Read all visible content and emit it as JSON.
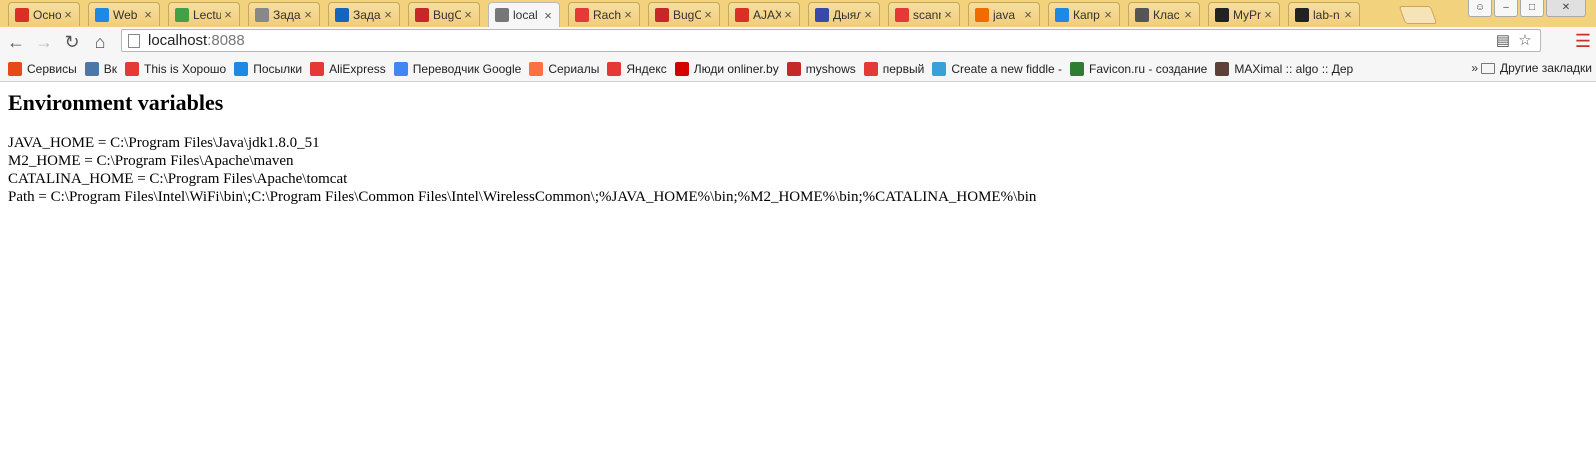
{
  "tabs": [
    {
      "title": "Осно",
      "icon": "person-icon",
      "color": "#d93025"
    },
    {
      "title": "Web",
      "icon": "drive-icon",
      "color": "#1e88e5"
    },
    {
      "title": "Lectu",
      "icon": "drive-icon",
      "color": "#43a047"
    },
    {
      "title": "Зада",
      "icon": "ir2-icon",
      "color": "#888888"
    },
    {
      "title": "Зада",
      "icon": "table-icon",
      "color": "#1565c0"
    },
    {
      "title": "BugC",
      "icon": "bug-icon",
      "color": "#c62828"
    },
    {
      "title": "local",
      "icon": "page-icon",
      "color": "#777777"
    },
    {
      "title": "Rach",
      "icon": "shop-icon",
      "color": "#e53935"
    },
    {
      "title": "BugC",
      "icon": "bug-icon",
      "color": "#c62828"
    },
    {
      "title": "AJAX",
      "icon": "person-icon",
      "color": "#d93025"
    },
    {
      "title": "Дыял",
      "icon": "chat-icon",
      "color": "#3949ab"
    },
    {
      "title": "scann",
      "icon": "yandex-icon",
      "color": "#e53935"
    },
    {
      "title": "java",
      "icon": "java-icon",
      "color": "#ef6c00"
    },
    {
      "title": "Капр",
      "icon": "nodes-icon",
      "color": "#1e88e5"
    },
    {
      "title": "Клас",
      "icon": "gear-icon",
      "color": "#555555"
    },
    {
      "title": "MyPr",
      "icon": "github-icon",
      "color": "#222222"
    },
    {
      "title": "lab-n",
      "icon": "github-icon",
      "color": "#222222"
    }
  ],
  "active_tab_index": 6,
  "address": {
    "host": "localhost",
    "port": ":8088"
  },
  "bookmarks": [
    {
      "label": "Сервисы",
      "icon": "apps-icon",
      "color": "#e64a19"
    },
    {
      "label": "Вк",
      "icon": "vk-icon",
      "color": "#4a76a8"
    },
    {
      "label": "This is Хорошо",
      "icon": "youtube-icon",
      "color": "#e53935"
    },
    {
      "label": "Посылки",
      "icon": "package-icon",
      "color": "#1e88e5"
    },
    {
      "label": "AliExpress",
      "icon": "aliexpress-icon",
      "color": "#e53935"
    },
    {
      "label": "Переводчик Google",
      "icon": "translate-icon",
      "color": "#4285f4"
    },
    {
      "label": "Сериалы",
      "icon": "flame-icon",
      "color": "#ff7043"
    },
    {
      "label": "Яндекс",
      "icon": "yandex-icon",
      "color": "#e53935"
    },
    {
      "label": "Люди onliner.by",
      "icon": "onliner-icon",
      "color": "#d50000"
    },
    {
      "label": "myshows",
      "icon": "tv-icon",
      "color": "#c62828"
    },
    {
      "label": "первый",
      "icon": "channel-one-icon",
      "color": "#e53935"
    },
    {
      "label": "Create a new fiddle -",
      "icon": "cloud-icon",
      "color": "#3aa0d8"
    },
    {
      "label": "Favicon.ru - создание",
      "icon": "creeper-icon",
      "color": "#2e7d32"
    },
    {
      "label": "MAXimal :: algo :: Дер",
      "icon": "maximal-icon",
      "color": "#5d4037"
    }
  ],
  "bookmarks_overflow": "»",
  "other_bookmarks": "Другие закладки",
  "page": {
    "heading": "Environment variables",
    "lines": [
      "JAVA_HOME = C:\\Program Files\\Java\\jdk1.8.0_51",
      "M2_HOME = C:\\Program Files\\Apache\\maven",
      "CATALINA_HOME = C:\\Program Files\\Apache\\tomcat",
      "Path = C:\\Program Files\\Intel\\WiFi\\bin\\;C:\\Program Files\\Common Files\\Intel\\WirelessCommon\\;%JAVA_HOME%\\bin;%M2_HOME%\\bin;%CATALINA_HOME%\\bin"
    ]
  },
  "colors": {
    "tabstrip": "#f2d27d",
    "toolbar": "#f6f6f6",
    "menu_accent": "#c9302c"
  }
}
